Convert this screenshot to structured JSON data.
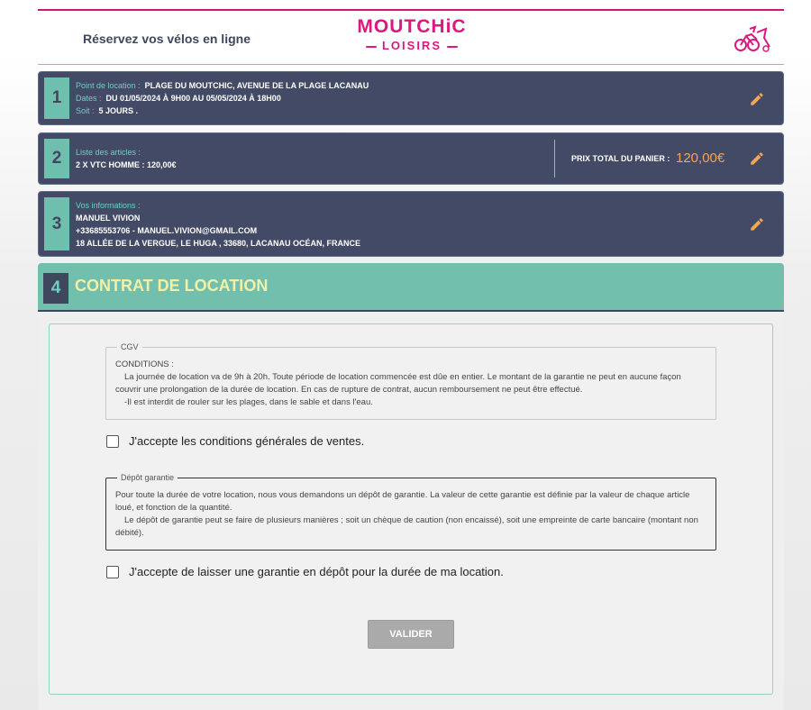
{
  "header": {
    "tagline": "Réservez vos vélos en ligne",
    "logo_line1": "MOUTCHiC",
    "logo_line2": "LOISIRS",
    "colors": {
      "brand": "#d9197f",
      "accent": "#6fbfae",
      "dark": "#424a66",
      "price": "#f4a557"
    }
  },
  "steps": {
    "s1": {
      "number": "1",
      "location_label": "Point de location :",
      "location_value": "PLAGE DU MOUTCHIC, AVENUE DE LA PLAGE LACANAU",
      "dates_label": "Dates :",
      "dates_value": "DU 01/05/2024 À 9H00 AU 05/05/2024 À 18H00",
      "duration_label": "Soit :",
      "duration_value": "5 JOURS .",
      "edit_icon": "pencil-icon"
    },
    "s2": {
      "number": "2",
      "items_label": "Liste des articles :",
      "items_value": "2 X VTC HOMME : 120,00€",
      "total_label": "PRIX TOTAL DU PANIER :",
      "total_value": "120,00€",
      "edit_icon": "pencil-icon"
    },
    "s3": {
      "number": "3",
      "info_label": "Vos informations :",
      "name": "MANUEL VIVION",
      "contact": "+33685553706 - MANUEL.VIVION@GMAIL.COM",
      "address": "18 ALLÉE DE LA VERGUE, LE HUGA , 33680, LACANAU OCÉAN, FRANCE",
      "edit_icon": "pencil-icon"
    },
    "s4": {
      "number": "4",
      "title": "CONTRAT DE LOCATION"
    }
  },
  "contract": {
    "cgv": {
      "legend": "CGV",
      "heading": "CONDITIONS :",
      "line1": "La journée de location va de 9h à 20h. Toute période de location commencée est dûe en entier. Le montant de la garantie ne peut en aucune façon",
      "line2": "couvrir une prolongation de la durée de location. En cas de rupture de contrat, aucun remboursement ne peut être effectué.",
      "line3": "-Il est interdit de rouler sur les plages, dans le sable et dans l'eau."
    },
    "accept_cgv": "J'accepte les conditions générales de ventes.",
    "deposit": {
      "legend": "Dépôt garantie",
      "line1": "Pour toute la durée de votre location, nous vous demandons un dépôt de garantie. La valeur de cette garantie est définie par la valeur de chaque article",
      "line2": "loué, et fonction de la quantité.",
      "line3": "Le dépôt de garantie peut se faire de plusieurs manières ; soit un chèque de caution (non encaissé), soit une empreinte de carte bancaire (montant non",
      "line4": "débité)."
    },
    "accept_deposit": "J'accepte de laisser une garantie en dépôt pour la durée de ma location.",
    "submit_label": "VALIDER"
  }
}
